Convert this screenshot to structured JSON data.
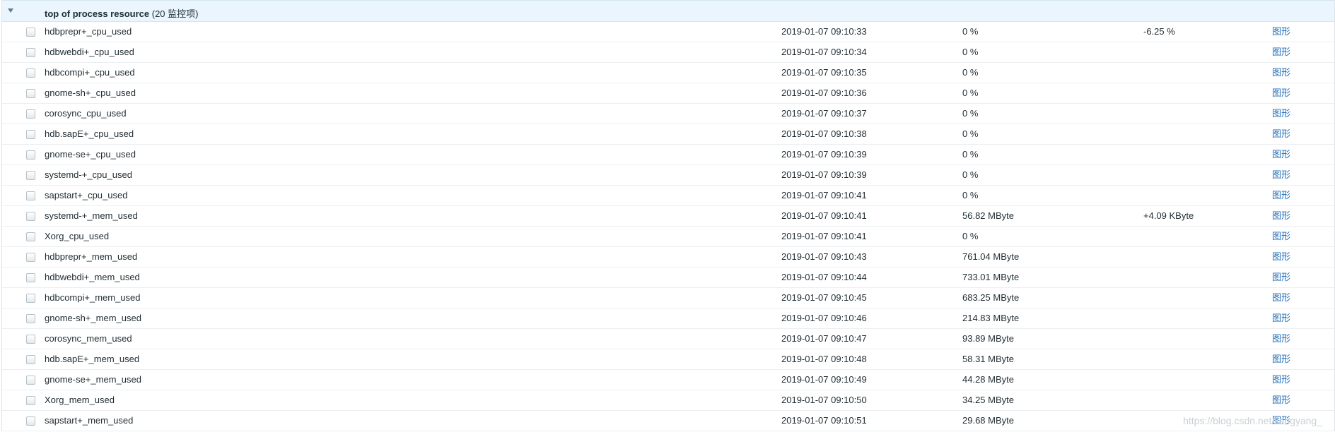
{
  "group": {
    "title": "top of process resource",
    "count": "(20 监控项)"
  },
  "rows": [
    {
      "name": "hdbprepr+_cpu_used",
      "time": "2019-01-07 09:10:33",
      "value": "0 %",
      "change": "-6.25 %",
      "graph": "图形"
    },
    {
      "name": "hdbwebdi+_cpu_used",
      "time": "2019-01-07 09:10:34",
      "value": "0 %",
      "change": "",
      "graph": "图形"
    },
    {
      "name": "hdbcompi+_cpu_used",
      "time": "2019-01-07 09:10:35",
      "value": "0 %",
      "change": "",
      "graph": "图形"
    },
    {
      "name": "gnome-sh+_cpu_used",
      "time": "2019-01-07 09:10:36",
      "value": "0 %",
      "change": "",
      "graph": "图形"
    },
    {
      "name": "corosync_cpu_used",
      "time": "2019-01-07 09:10:37",
      "value": "0 %",
      "change": "",
      "graph": "图形"
    },
    {
      "name": "hdb.sapE+_cpu_used",
      "time": "2019-01-07 09:10:38",
      "value": "0 %",
      "change": "",
      "graph": "图形"
    },
    {
      "name": "gnome-se+_cpu_used",
      "time": "2019-01-07 09:10:39",
      "value": "0 %",
      "change": "",
      "graph": "图形"
    },
    {
      "name": "systemd-+_cpu_used",
      "time": "2019-01-07 09:10:39",
      "value": "0 %",
      "change": "",
      "graph": "图形"
    },
    {
      "name": "sapstart+_cpu_used",
      "time": "2019-01-07 09:10:41",
      "value": "0 %",
      "change": "",
      "graph": "图形"
    },
    {
      "name": "systemd-+_mem_used",
      "time": "2019-01-07 09:10:41",
      "value": "56.82 MByte",
      "change": "+4.09 KByte",
      "graph": "图形"
    },
    {
      "name": "Xorg_cpu_used",
      "time": "2019-01-07 09:10:41",
      "value": "0 %",
      "change": "",
      "graph": "图形"
    },
    {
      "name": "hdbprepr+_mem_used",
      "time": "2019-01-07 09:10:43",
      "value": "761.04 MByte",
      "change": "",
      "graph": "图形"
    },
    {
      "name": "hdbwebdi+_mem_used",
      "time": "2019-01-07 09:10:44",
      "value": "733.01 MByte",
      "change": "",
      "graph": "图形"
    },
    {
      "name": "hdbcompi+_mem_used",
      "time": "2019-01-07 09:10:45",
      "value": "683.25 MByte",
      "change": "",
      "graph": "图形"
    },
    {
      "name": "gnome-sh+_mem_used",
      "time": "2019-01-07 09:10:46",
      "value": "214.83 MByte",
      "change": "",
      "graph": "图形"
    },
    {
      "name": "corosync_mem_used",
      "time": "2019-01-07 09:10:47",
      "value": "93.89 MByte",
      "change": "",
      "graph": "图形"
    },
    {
      "name": "hdb.sapE+_mem_used",
      "time": "2019-01-07 09:10:48",
      "value": "58.31 MByte",
      "change": "",
      "graph": "图形"
    },
    {
      "name": "gnome-se+_mem_used",
      "time": "2019-01-07 09:10:49",
      "value": "44.28 MByte",
      "change": "",
      "graph": "图形"
    },
    {
      "name": "Xorg_mem_used",
      "time": "2019-01-07 09:10:50",
      "value": "34.25 MByte",
      "change": "",
      "graph": "图形"
    },
    {
      "name": "sapstart+_mem_used",
      "time": "2019-01-07 09:10:51",
      "value": "29.68 MByte",
      "change": "",
      "graph": "图形"
    }
  ],
  "watermark": "https://blog.csdn.net/liangyang_"
}
